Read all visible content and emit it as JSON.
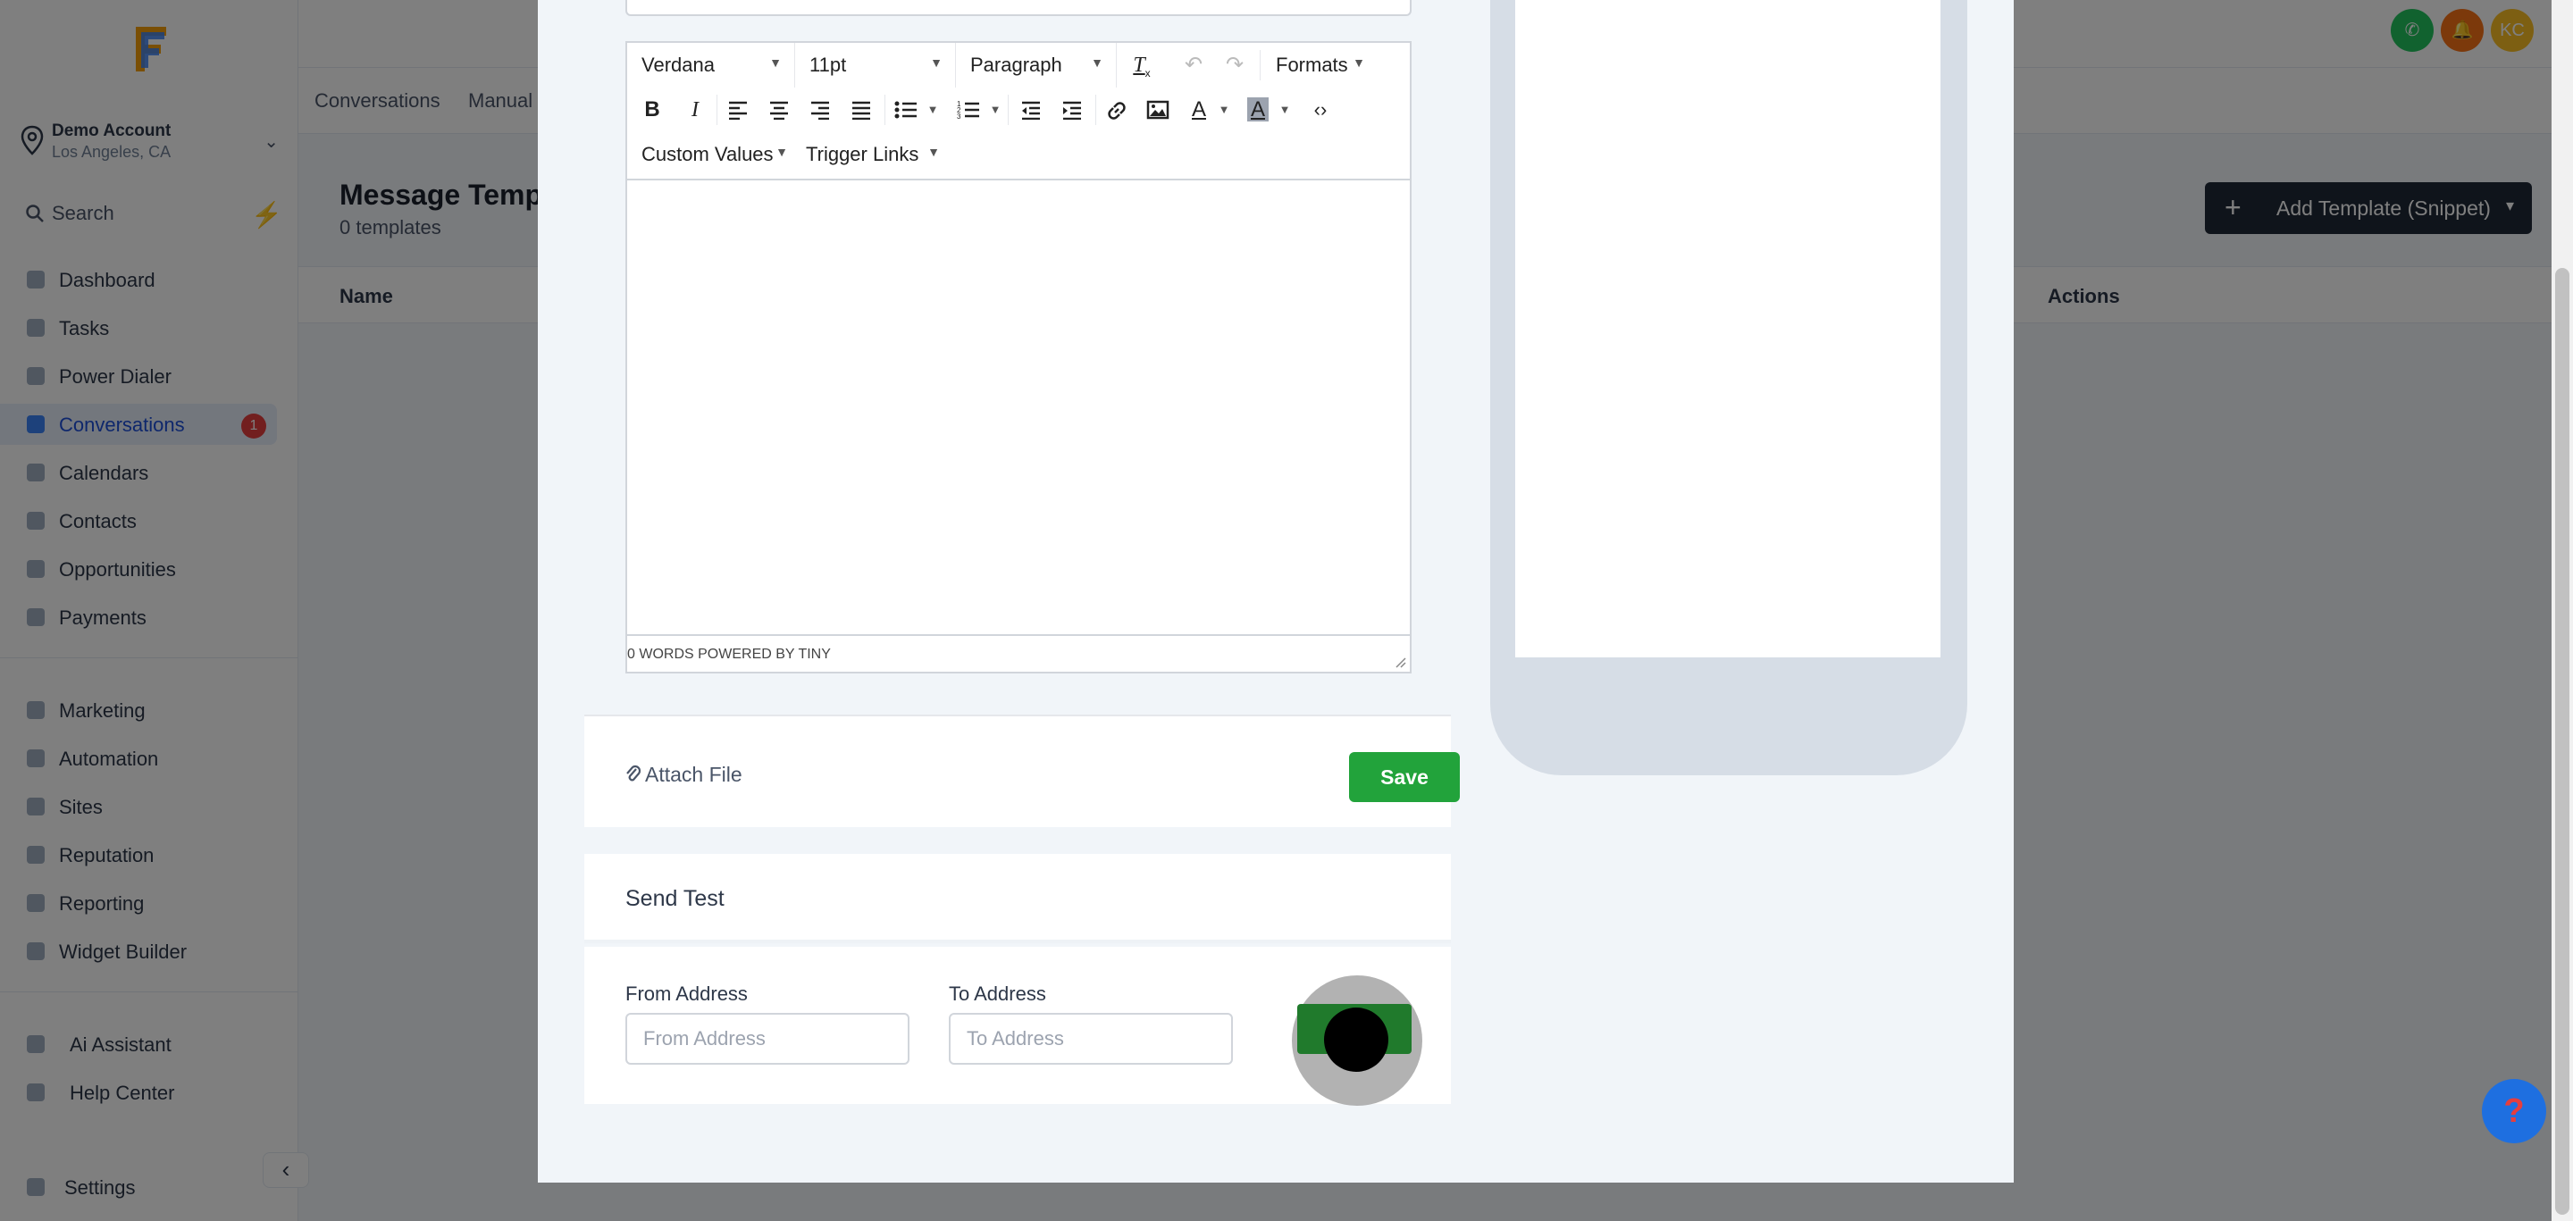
{
  "sidebar": {
    "account_name": "Demo Account",
    "account_location": "Los Angeles, CA",
    "search_placeholder": "Search",
    "items": [
      {
        "label": "Dashboard"
      },
      {
        "label": "Tasks"
      },
      {
        "label": "Power Dialer"
      },
      {
        "label": "Conversations",
        "badge": "1"
      },
      {
        "label": "Calendars"
      },
      {
        "label": "Contacts"
      },
      {
        "label": "Opportunities"
      },
      {
        "label": "Payments"
      },
      {
        "label": "Marketing"
      },
      {
        "label": "Automation"
      },
      {
        "label": "Sites"
      },
      {
        "label": "Reputation"
      },
      {
        "label": "Reporting"
      },
      {
        "label": "Widget Builder"
      },
      {
        "label": "Ai Assistant"
      },
      {
        "label": "Help Center"
      },
      {
        "label": "Settings"
      }
    ]
  },
  "topbar": {
    "avatar_initials": "KC"
  },
  "subnav": {
    "tab_conversations": "Conversations",
    "tab_manual": "Manual"
  },
  "page": {
    "title": "Message Templ",
    "subtitle": "0 templates",
    "add_button": "Add Template (Snippet)",
    "col_name": "Name",
    "col_actions": "Actions"
  },
  "editor": {
    "font_family": "Verdana",
    "font_size": "11pt",
    "block_format": "Paragraph",
    "formats_menu": "Formats",
    "custom_values_menu": "Custom Values",
    "trigger_links_menu": "Trigger Links",
    "status_text": "0 WORDS POWERED BY TINY"
  },
  "footer": {
    "attach_label": "Attach File",
    "save_label": "Save"
  },
  "send_test": {
    "title": "Send Test",
    "from_label": "From Address",
    "from_placeholder": "From Address",
    "to_label": "To Address",
    "to_placeholder": "To Address"
  },
  "help_fab": "?",
  "colors": {
    "save_green": "#22a33b",
    "accent_blue": "#1e6fe0",
    "badge_red": "#e53e3e"
  }
}
